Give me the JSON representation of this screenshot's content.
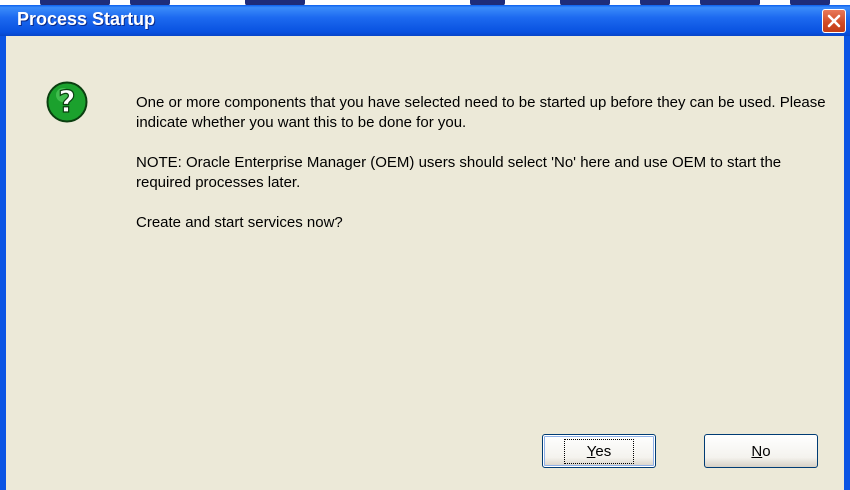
{
  "dialog": {
    "title": "Process Startup",
    "icon": "question-icon",
    "message": {
      "paragraph1": "One or more components that you have selected need to be started up before they can be used.  Please indicate whether you want this to be done for you.",
      "paragraph2": "NOTE: Oracle Enterprise Manager (OEM) users should select 'No' here and use OEM to start the required processes later.",
      "question": "Create and start services now?"
    },
    "buttons": {
      "yes": {
        "mnemonic": "Y",
        "rest": "es"
      },
      "no": {
        "mnemonic": "N",
        "rest": "o"
      }
    }
  },
  "colors": {
    "titlebar": "#0A54E4",
    "client": "#ECE9D8",
    "close_button": "#D04A24",
    "icon_green": "#1BA12D"
  }
}
